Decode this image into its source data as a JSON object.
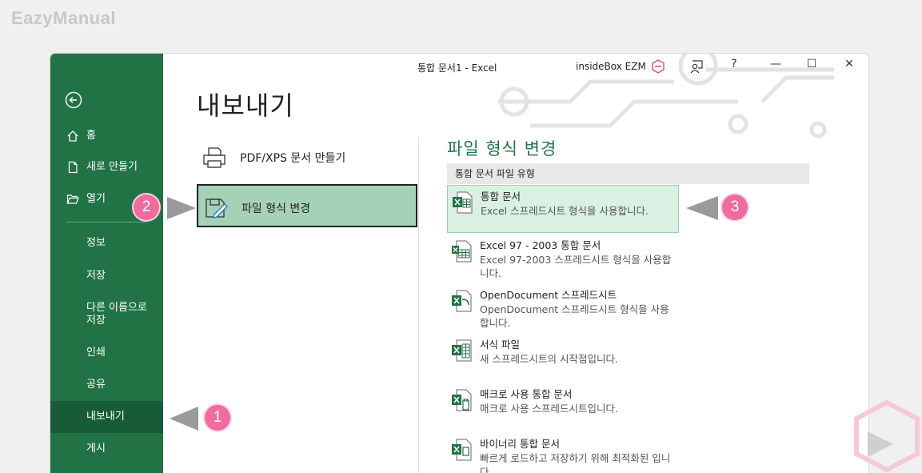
{
  "watermark": "EazyManual",
  "titlebar": {
    "document": "통합 문서1  -  Excel",
    "user": "insideBox EZM",
    "help": "?",
    "minimize": "—",
    "maximize": "☐",
    "close": "✕"
  },
  "sidebar": {
    "items": [
      {
        "label": "홈",
        "icon": "home-icon"
      },
      {
        "label": "새로 만들기",
        "icon": "new-file-icon"
      },
      {
        "label": "열기",
        "icon": "folder-open-icon"
      }
    ],
    "sub_items": [
      {
        "label": "정보"
      },
      {
        "label": "저장"
      },
      {
        "label": "다른 이름으로 저장"
      },
      {
        "label": "인쇄"
      },
      {
        "label": "공유"
      },
      {
        "label": "내보내기"
      },
      {
        "label": "게시"
      }
    ],
    "active": "내보내기"
  },
  "page_title": "내보내기",
  "export_options": [
    {
      "label": "PDF/XPS 문서 만들기",
      "icon": "printer-icon"
    },
    {
      "label": "파일 형식 변경",
      "icon": "file-edit-icon",
      "selected": true
    }
  ],
  "file_types": {
    "title": "파일 형식 변경",
    "group_header": "통합 문서 파일 유형",
    "items": [
      {
        "name": "통합 문서",
        "desc": "Excel 스프레드시트 형식을 사용합니다.",
        "selected": true
      },
      {
        "name": "Excel 97 - 2003 통합 문서",
        "desc": "Excel 97-2003 스프레드시트 형식을 사용합니다."
      },
      {
        "name": "OpenDocument 스프레드시트",
        "desc": "OpenDocument 스프레드시트 형식을 사용합니다."
      },
      {
        "name": "서식 파일",
        "desc": "새 스프레드시트의 시작점입니다."
      },
      {
        "name": "매크로 사용 통합 문서",
        "desc": "매크로 사용 스프레드시트입니다."
      },
      {
        "name": "바이너리 통합 문서",
        "desc": "빠르게 로드하고 저장하기 위해 최적화된 입니다."
      }
    ]
  },
  "callouts": [
    "1",
    "2",
    "3"
  ],
  "colors": {
    "excel_green": "#217346",
    "active_nav": "#185c37",
    "selected_option": "#a5d2b7",
    "badge": "#f06ba0"
  }
}
